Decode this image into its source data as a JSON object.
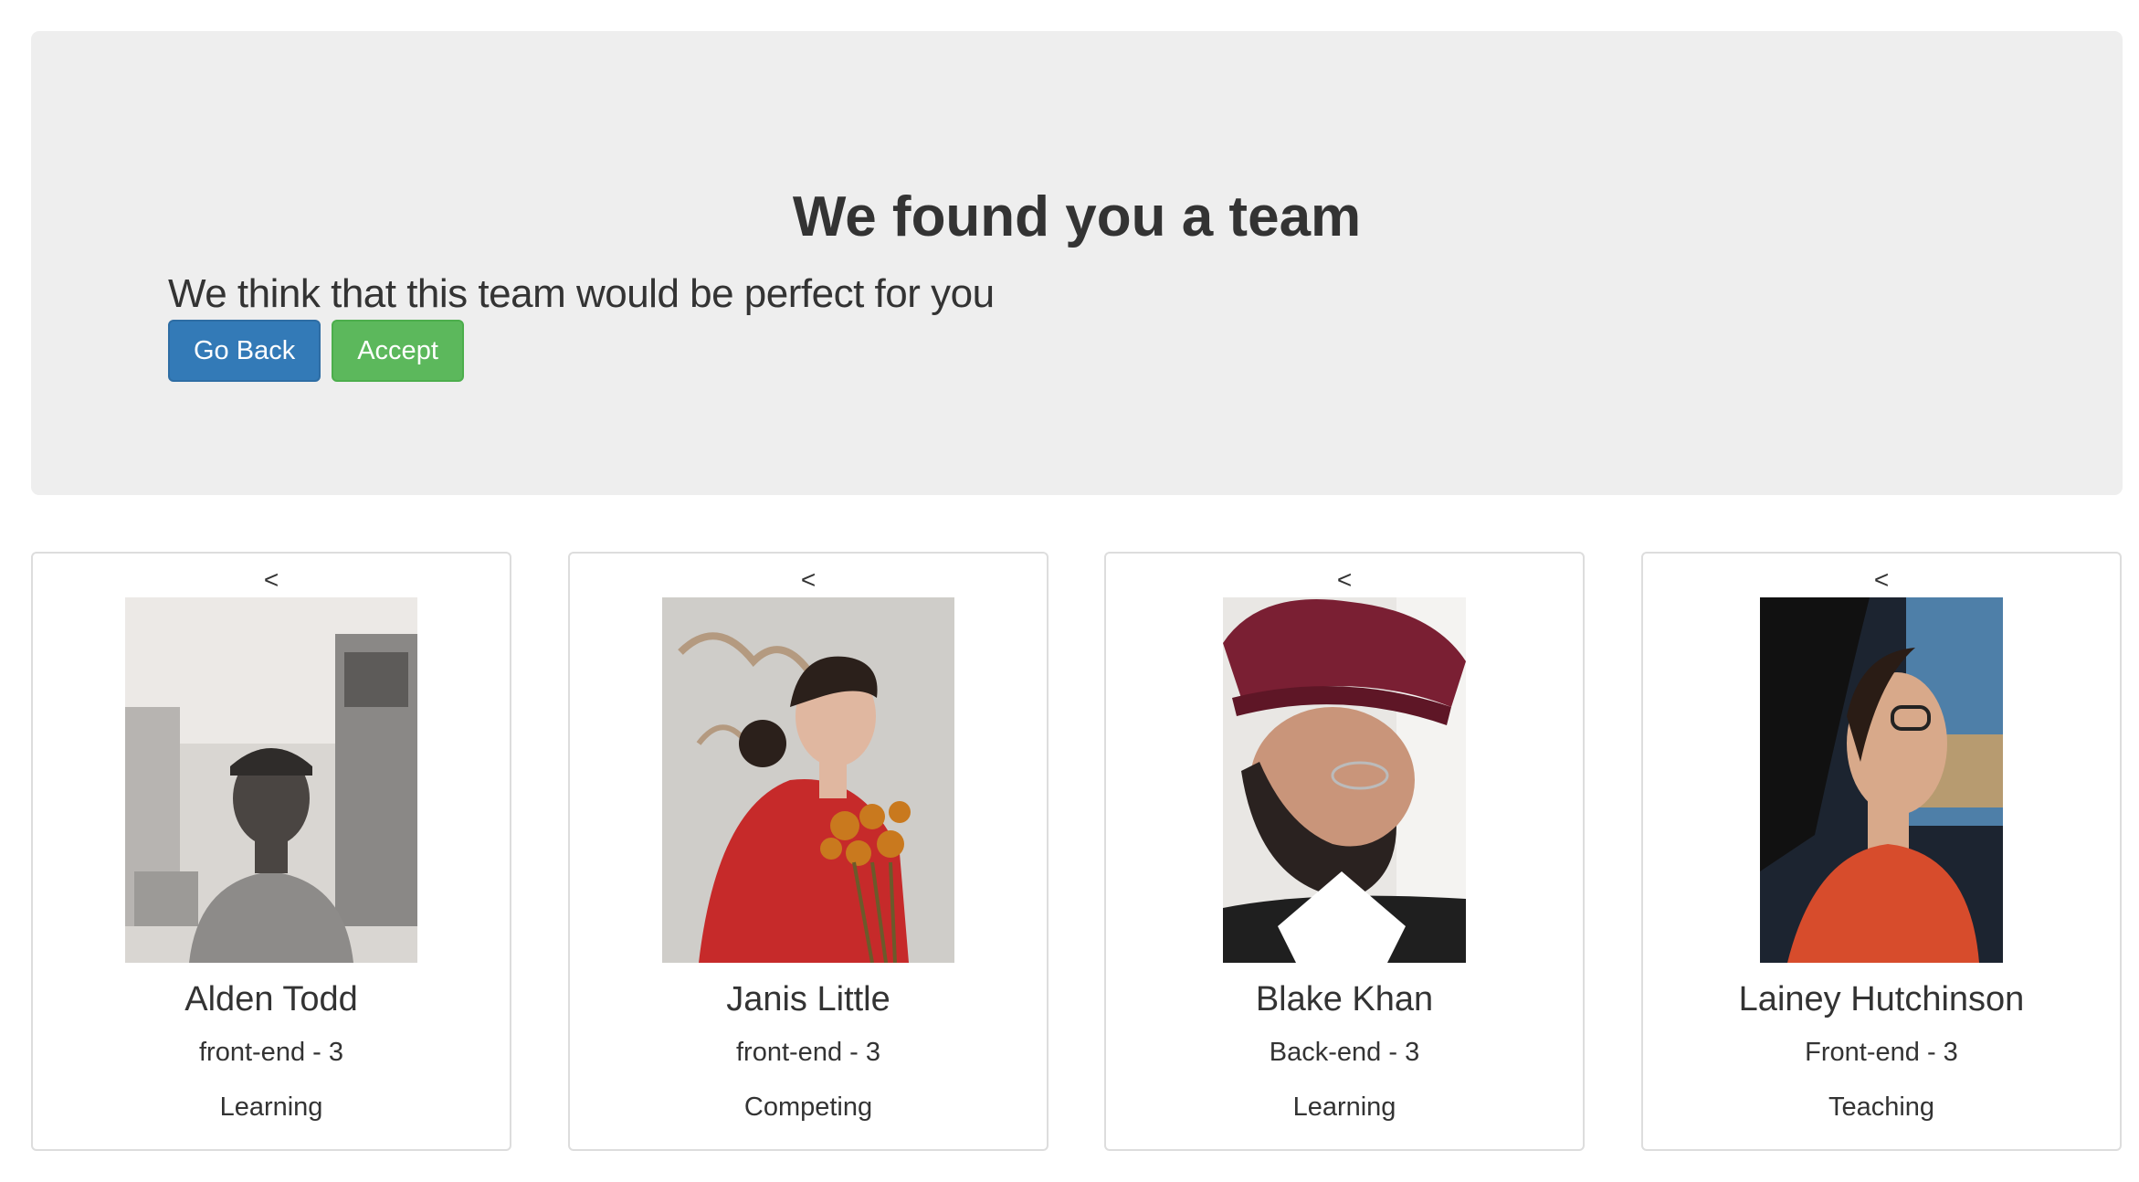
{
  "header": {
    "title": "We found you a team",
    "lead": "We think that this team would be perfect for you",
    "go_back_label": "Go Back",
    "accept_label": "Accept"
  },
  "members": [
    {
      "nav": "<",
      "name": "Alden Todd",
      "role": "front-end - 3",
      "goal": "Learning"
    },
    {
      "nav": "<",
      "name": "Janis Little",
      "role": "front-end - 3",
      "goal": "Competing"
    },
    {
      "nav": "<",
      "name": "Blake Khan",
      "role": "Back-end - 3",
      "goal": "Learning"
    },
    {
      "nav": "<",
      "name": "Lainey Hutchinson",
      "role": "Front-end - 3",
      "goal": "Teaching"
    }
  ],
  "colors": {
    "primary": "#337ab7",
    "success": "#5cb85c",
    "jumbotron_bg": "#eeeeee"
  }
}
